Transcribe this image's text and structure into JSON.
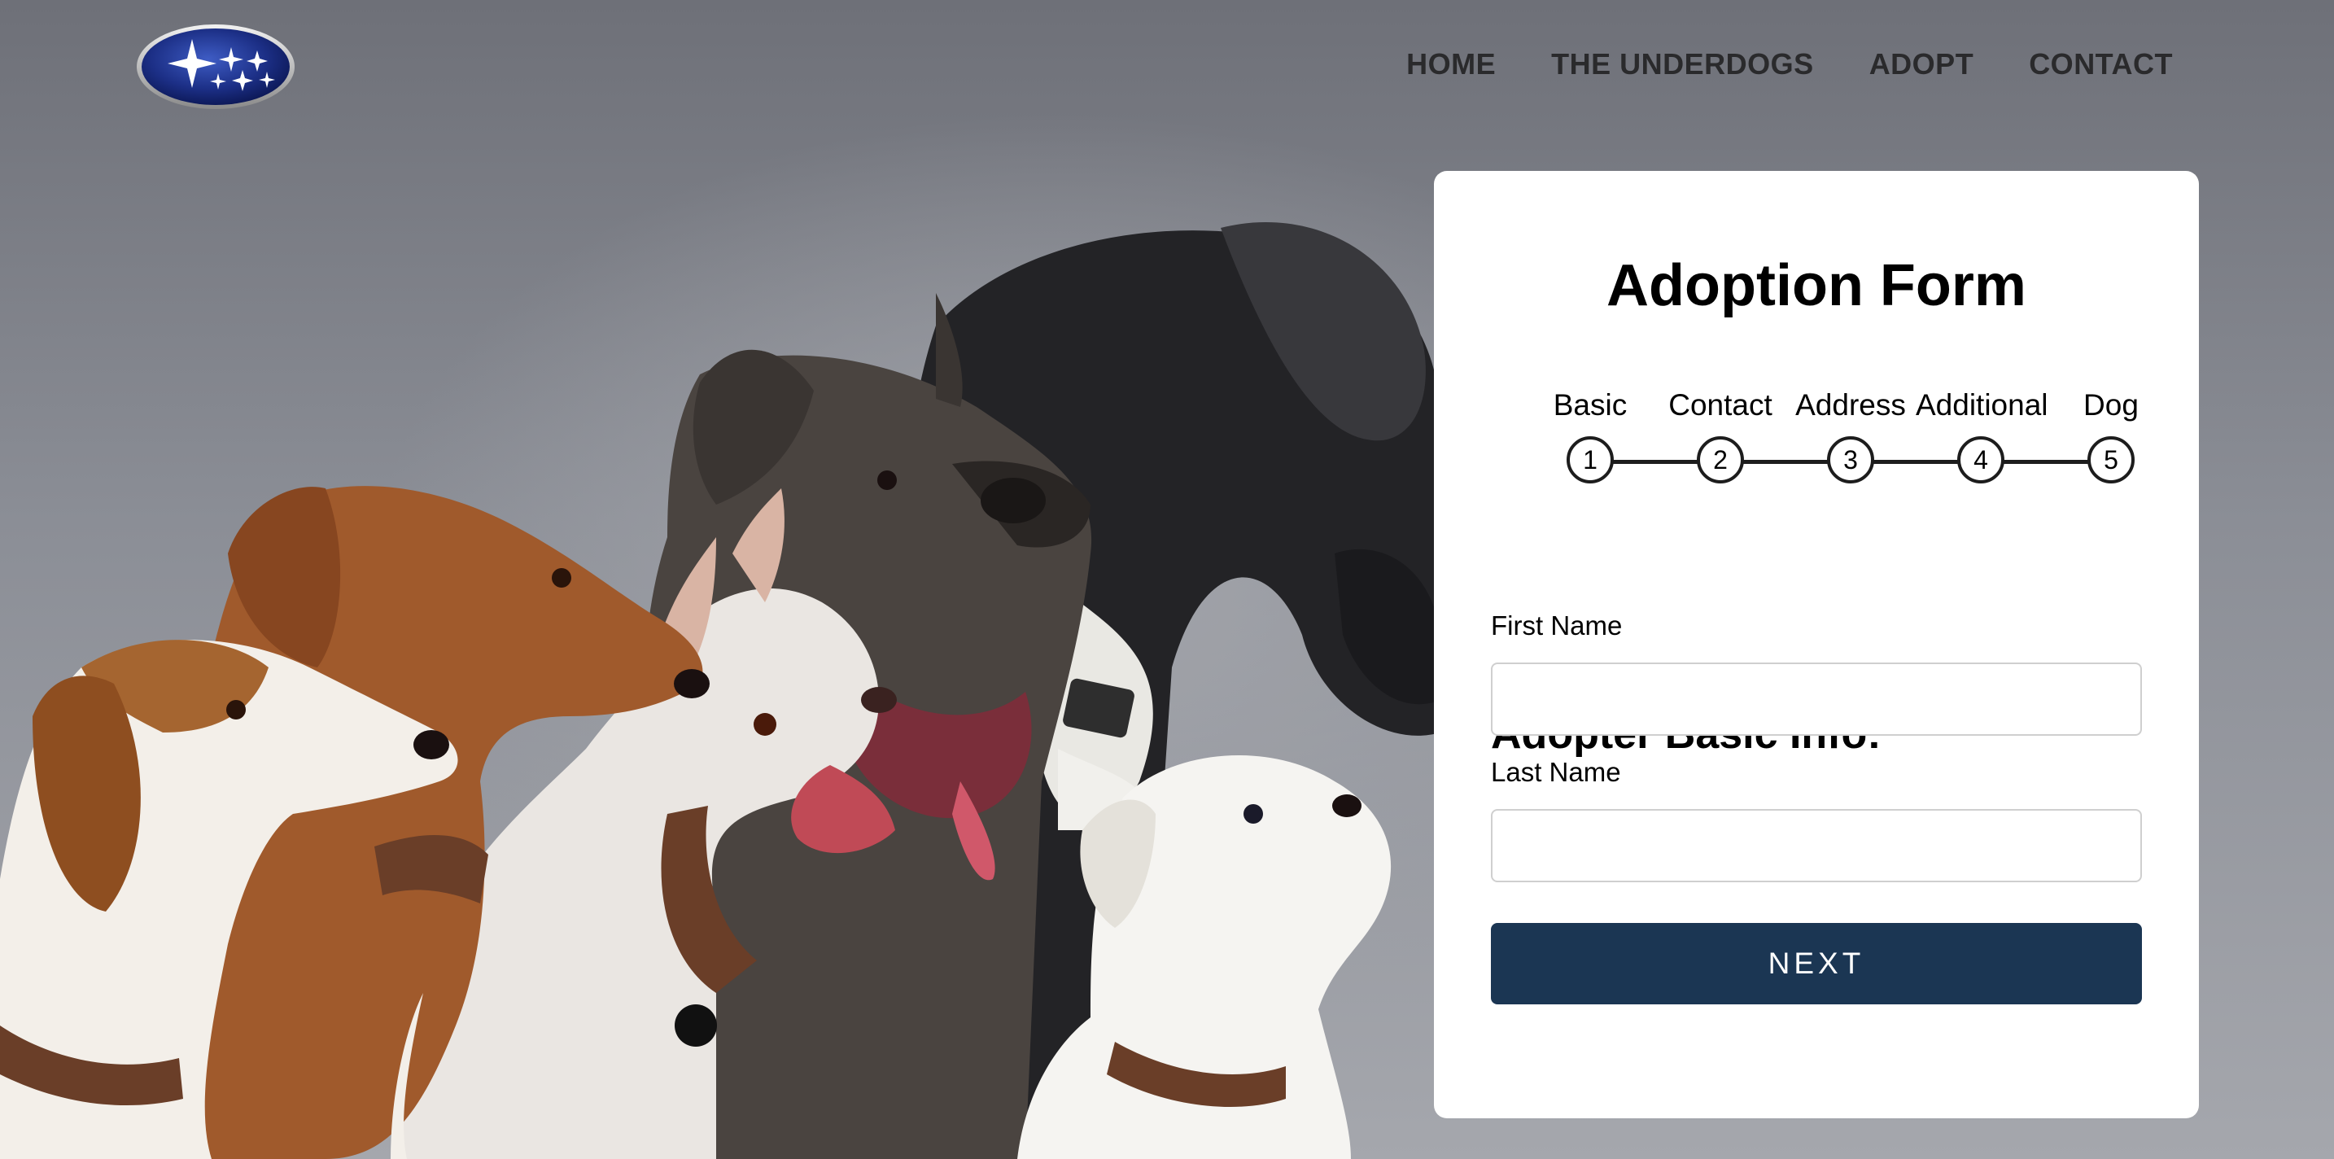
{
  "nav": {
    "items": [
      {
        "label": "HOME"
      },
      {
        "label": "THE UNDERDOGS"
      },
      {
        "label": "ADOPT"
      },
      {
        "label": "CONTACT"
      }
    ]
  },
  "form": {
    "title": "Adoption Form",
    "steps": [
      {
        "label": "Basic",
        "number": "1"
      },
      {
        "label": "Contact",
        "number": "2"
      },
      {
        "label": "Address",
        "number": "3"
      },
      {
        "label": "Additional",
        "number": "4"
      },
      {
        "label": "Dog",
        "number": "5"
      }
    ],
    "section_heading": "Adopter Basic Info:",
    "first_name": {
      "label": "First Name",
      "value": ""
    },
    "last_name": {
      "label": "Last Name",
      "value": ""
    },
    "next_label": "NEXT"
  },
  "colors": {
    "button_bg": "#1b3653",
    "logo_blue": "#1c2f86",
    "text": "#2a2a2c"
  },
  "icons": {
    "logo": "subaru-logo",
    "hero": "group-of-dogs-photo"
  }
}
